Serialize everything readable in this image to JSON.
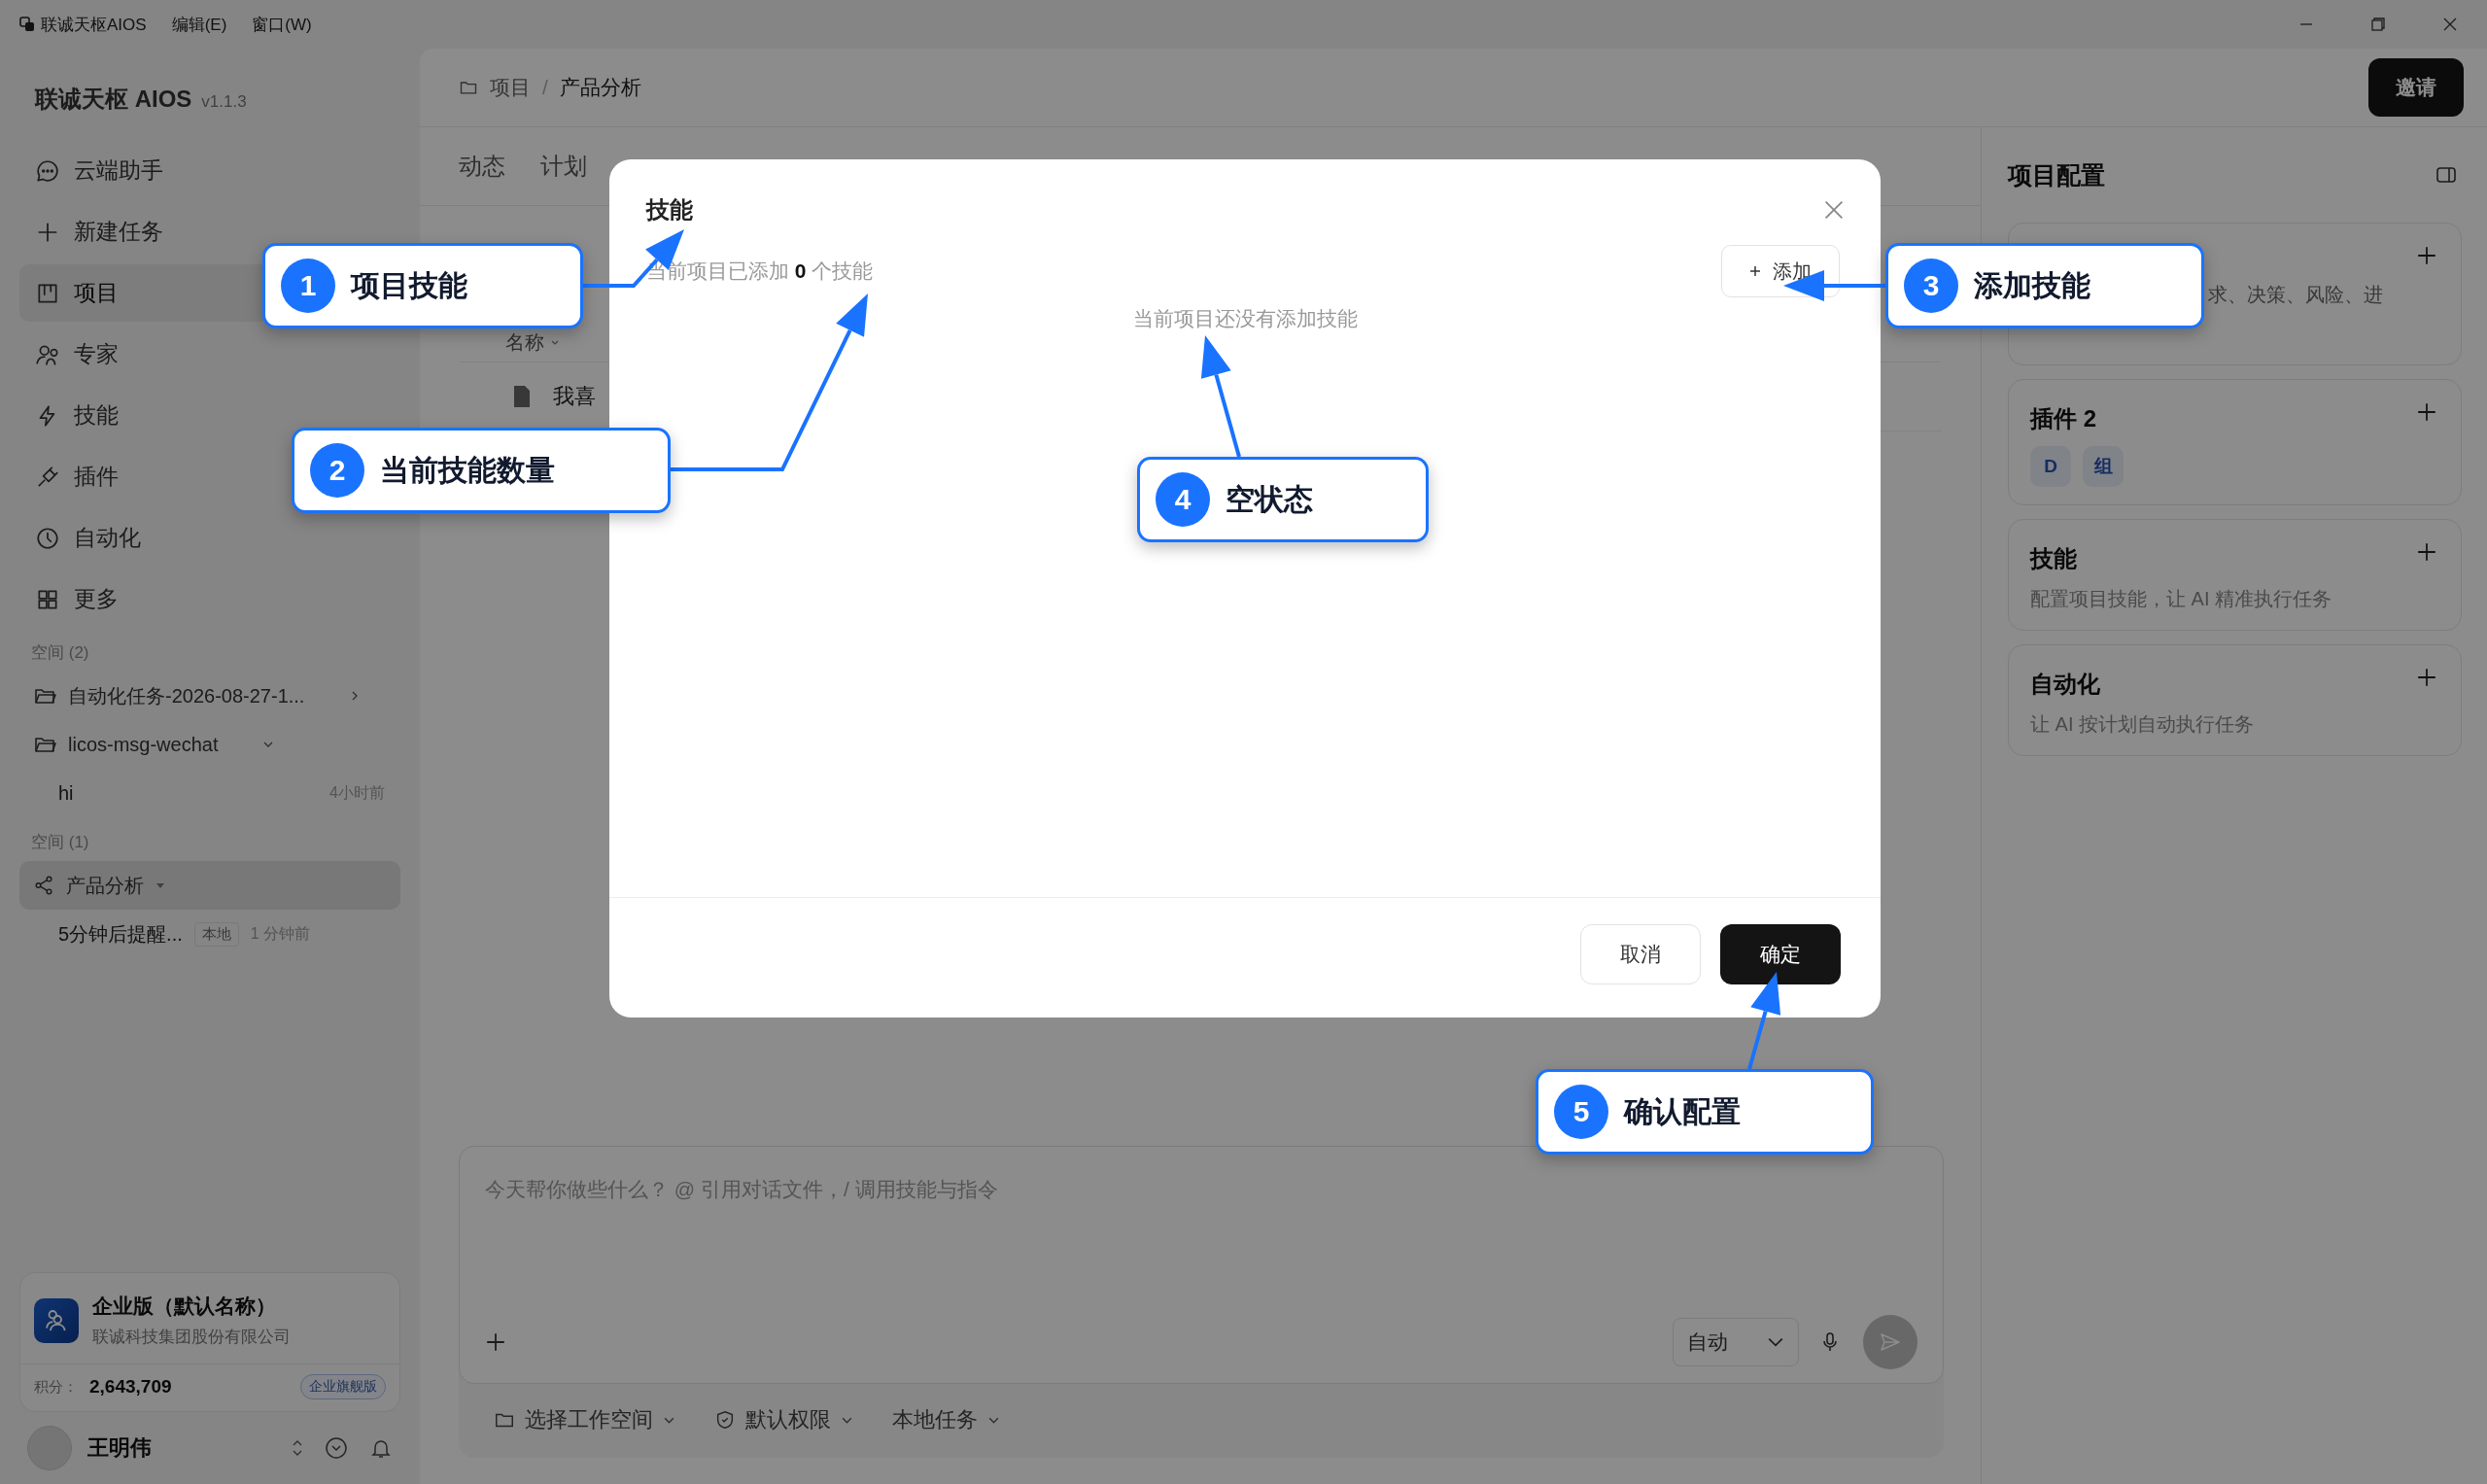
{
  "titlebar": {
    "app": "联诚天枢AIOS",
    "menus": [
      "编辑(E)",
      "窗口(W)"
    ]
  },
  "sidebar": {
    "brand": "联诚天枢 AIOS",
    "version": "v1.1.3",
    "nav": [
      {
        "label": "云端助手",
        "selected": false
      },
      {
        "label": "新建任务",
        "selected": false
      },
      {
        "label": "项目",
        "selected": true
      },
      {
        "label": "专家",
        "selected": false
      },
      {
        "label": "技能",
        "selected": false
      },
      {
        "label": "插件",
        "selected": false
      },
      {
        "label": "自动化",
        "selected": false
      },
      {
        "label": "更多",
        "selected": false
      }
    ],
    "space_groups": [
      {
        "heading": "空间 (2)",
        "items": [
          {
            "kind": "folder",
            "label": "自动化任务-2026-08-27-1...",
            "expanded": false,
            "selected": false
          },
          {
            "kind": "folder",
            "label": "licos-msg-wechat",
            "expanded": true,
            "selected": false,
            "children": [
              {
                "label": "hi",
                "time": "4小时前"
              }
            ]
          }
        ]
      },
      {
        "heading": "空间 (1)",
        "items": [
          {
            "kind": "project",
            "label": "产品分析",
            "expanded": true,
            "selected": true,
            "children": [
              {
                "label": "5分钟后提醒...",
                "tag": "本地",
                "time": "1 分钟前"
              }
            ]
          }
        ]
      }
    ],
    "org_card": {
      "name": "企业版（默认名称）",
      "company": "联诚科技集团股份有限公司",
      "points_label": "积分：",
      "points": "2,643,709",
      "plan": "企业旗舰版"
    },
    "user": {
      "name": "王明伟"
    }
  },
  "header": {
    "breadcrumb": [
      "项目",
      "产品分析"
    ],
    "separator": "/",
    "invite": "邀请"
  },
  "tabs": [
    {
      "label": "动态",
      "selected": false
    },
    {
      "label": "计划",
      "selected": false
    }
  ],
  "table": {
    "column": "名称",
    "rows": [
      "我喜"
    ]
  },
  "right_panel": {
    "title": "项目配置",
    "cards": [
      {
        "kind": "text",
        "description": "求、决策、风险、进"
      },
      {
        "kind": "chips",
        "title": "插件 2",
        "chips": [
          "D",
          "组"
        ]
      },
      {
        "kind": "text",
        "title": "技能",
        "description": "配置项目技能，让 AI 精准执行任务"
      },
      {
        "kind": "text",
        "title": "自动化",
        "description": "让 AI 按计划自动执行任务"
      }
    ]
  },
  "composer": {
    "placeholder": "今天帮你做些什么？ @ 引用对话文件，/ 调用技能与指令",
    "mode": "自动",
    "options": [
      "选择工作空间",
      "默认权限",
      "本地任务"
    ]
  },
  "modal": {
    "title": "技能",
    "count_text": "当前项目已添加 **0** 个技能",
    "add": "添加",
    "empty": "当前项目还没有添加技能",
    "cancel": "取消",
    "ok": "确定"
  },
  "annotations": [
    {
      "number": "1",
      "label": "项目技能"
    },
    {
      "number": "2",
      "label": "当前技能数量"
    },
    {
      "number": "3",
      "label": "添加技能"
    },
    {
      "number": "4",
      "label": "空状态"
    },
    {
      "number": "5",
      "label": "确认配置"
    }
  ]
}
